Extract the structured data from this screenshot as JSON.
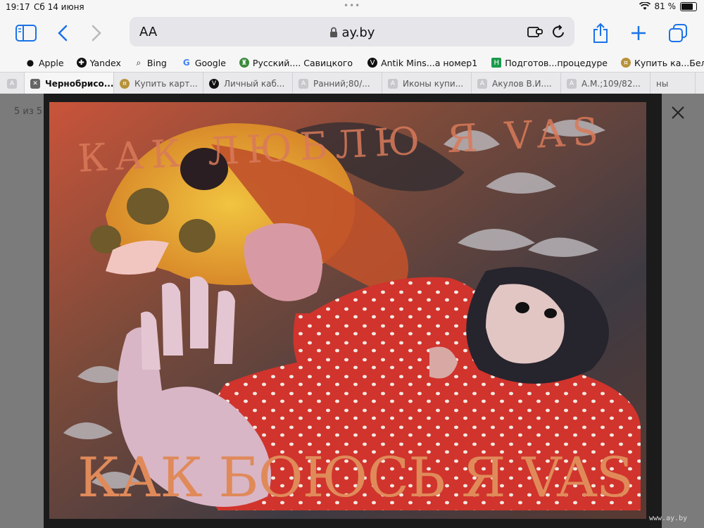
{
  "status": {
    "time": "19:17",
    "date": "Сб 14 июня",
    "battery_label": "81 %",
    "battery_level": 0.81
  },
  "toolbar": {
    "text_size": "AA",
    "url": "ay.by"
  },
  "bookmarks": [
    {
      "label": "Apple",
      "icon": "apple-icon"
    },
    {
      "label": "Yandex",
      "icon": "yandex-icon"
    },
    {
      "label": "Bing",
      "icon": "bing-icon"
    },
    {
      "label": "Google",
      "icon": "google-icon"
    },
    {
      "label": "Русский.... Савицкого",
      "icon": "museum-icon"
    },
    {
      "label": "Antik Mins...а номер1",
      "icon": "antik-icon"
    },
    {
      "label": "Подготов...процедуре",
      "icon": "h-icon"
    },
    {
      "label": "Купить ка...Беларуси",
      "icon": "coin-icon"
    }
  ],
  "tabs": [
    {
      "label": "",
      "icon": "a-icon"
    },
    {
      "label": "Чернобрисо...",
      "icon": "close-icon",
      "active": true
    },
    {
      "label": "Купить карт...",
      "icon": "coin-icon"
    },
    {
      "label": "Личный каб...",
      "icon": "antik-icon"
    },
    {
      "label": "Ранний;80/...",
      "icon": "a-icon"
    },
    {
      "label": "Иконы купи...",
      "icon": "a-icon"
    },
    {
      "label": "Акулов В.И....",
      "icon": "a-icon"
    },
    {
      "label": "А.М.;109/82...",
      "icon": "a-icon"
    },
    {
      "label": "ны",
      "icon": ""
    }
  ],
  "viewer": {
    "counter": "5 из 5",
    "watermark": "www.ay.by"
  },
  "painting": {
    "text_top": "КАК ЛЮБЛЮ Я VAS",
    "text_bottom": "КАК БОЮСЬ Я VAS"
  },
  "colors": {
    "accent": "#1a73e8",
    "chrome": "#f6f6f6",
    "overlay": "#7b7b7b"
  }
}
